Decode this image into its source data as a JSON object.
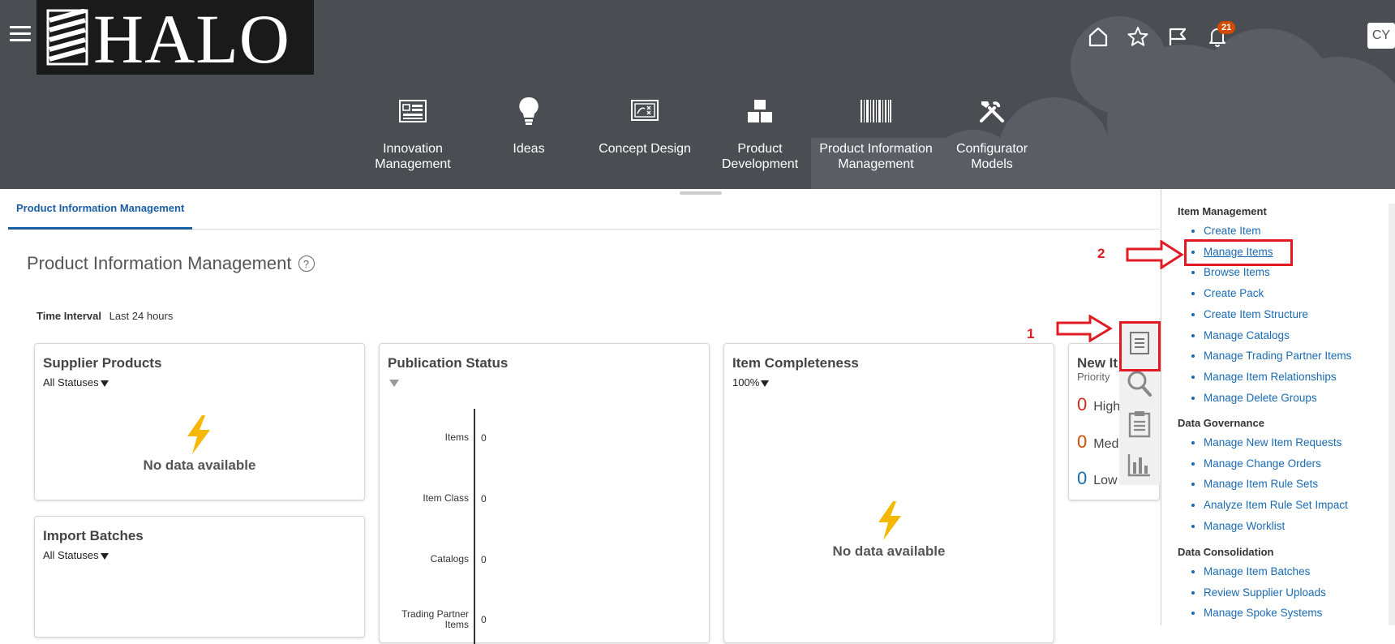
{
  "header": {
    "logo_text": "HALO",
    "notification_count": "21",
    "user_initials": "CY"
  },
  "nav": {
    "items": [
      {
        "label": "Innovation\nManagement",
        "icon": "dashboard-icon"
      },
      {
        "label": "Ideas",
        "icon": "lightbulb-icon"
      },
      {
        "label": "Concept Design",
        "icon": "concept-board-icon"
      },
      {
        "label": "Product\nDevelopment",
        "icon": "blocks-icon"
      },
      {
        "label": "Product Information\nManagement",
        "icon": "barcode-icon"
      },
      {
        "label": "Configurator\nModels",
        "icon": "tools-icon"
      }
    ]
  },
  "tab": {
    "label": "Product Information Management"
  },
  "page": {
    "title": "Product Information Management",
    "help_glyph": "?",
    "time_interval_label": "Time Interval",
    "time_interval_value": "Last 24 hours"
  },
  "cards": {
    "supplier_products": {
      "title": "Supplier Products",
      "filter": "All Statuses",
      "empty": "No data available"
    },
    "import_batches": {
      "title": "Import Batches",
      "filter": "All Statuses"
    },
    "publication_status": {
      "title": "Publication Status",
      "rows": [
        {
          "label": "Items",
          "value": "0"
        },
        {
          "label": "Item Class",
          "value": "0"
        },
        {
          "label": "Catalogs",
          "value": "0"
        },
        {
          "label": "Trading Partner Items",
          "value": "0"
        }
      ]
    },
    "item_completeness": {
      "title": "Item Completeness",
      "filter": "100%",
      "empty": "No data available"
    },
    "new_items": {
      "title": "New It",
      "subtitle": "Priority",
      "rows": [
        {
          "count": "0",
          "label": "High",
          "color": "#d02b1f"
        },
        {
          "count": "0",
          "label": "Med",
          "color": "#d24b00"
        },
        {
          "count": "0",
          "label": "Low",
          "color": "#1a6ab1"
        }
      ]
    }
  },
  "right_panel": {
    "groups": [
      {
        "head": "Item Management",
        "items": [
          "Create Item",
          "Manage Items",
          "Browse Items",
          "Create Pack",
          "Create Item Structure",
          "Manage Catalogs",
          "Manage Trading Partner Items",
          "Manage Item Relationships",
          "Manage Delete Groups"
        ]
      },
      {
        "head": "Data Governance",
        "items": [
          "Manage New Item Requests",
          "Manage Change Orders",
          "Manage Item Rule Sets",
          "Analyze Item Rule Set Impact",
          "Manage Worklist"
        ]
      },
      {
        "head": "Data Consolidation",
        "items": [
          "Manage Item Batches",
          "Review Supplier Uploads",
          "Manage Spoke Systems"
        ]
      }
    ]
  },
  "annotations": {
    "step1": "1",
    "step2": "2"
  },
  "colors": {
    "header_bg": "#4a4d52",
    "link": "#1a6ab1",
    "annotation": "#e01b24",
    "badge": "#d24b00"
  }
}
